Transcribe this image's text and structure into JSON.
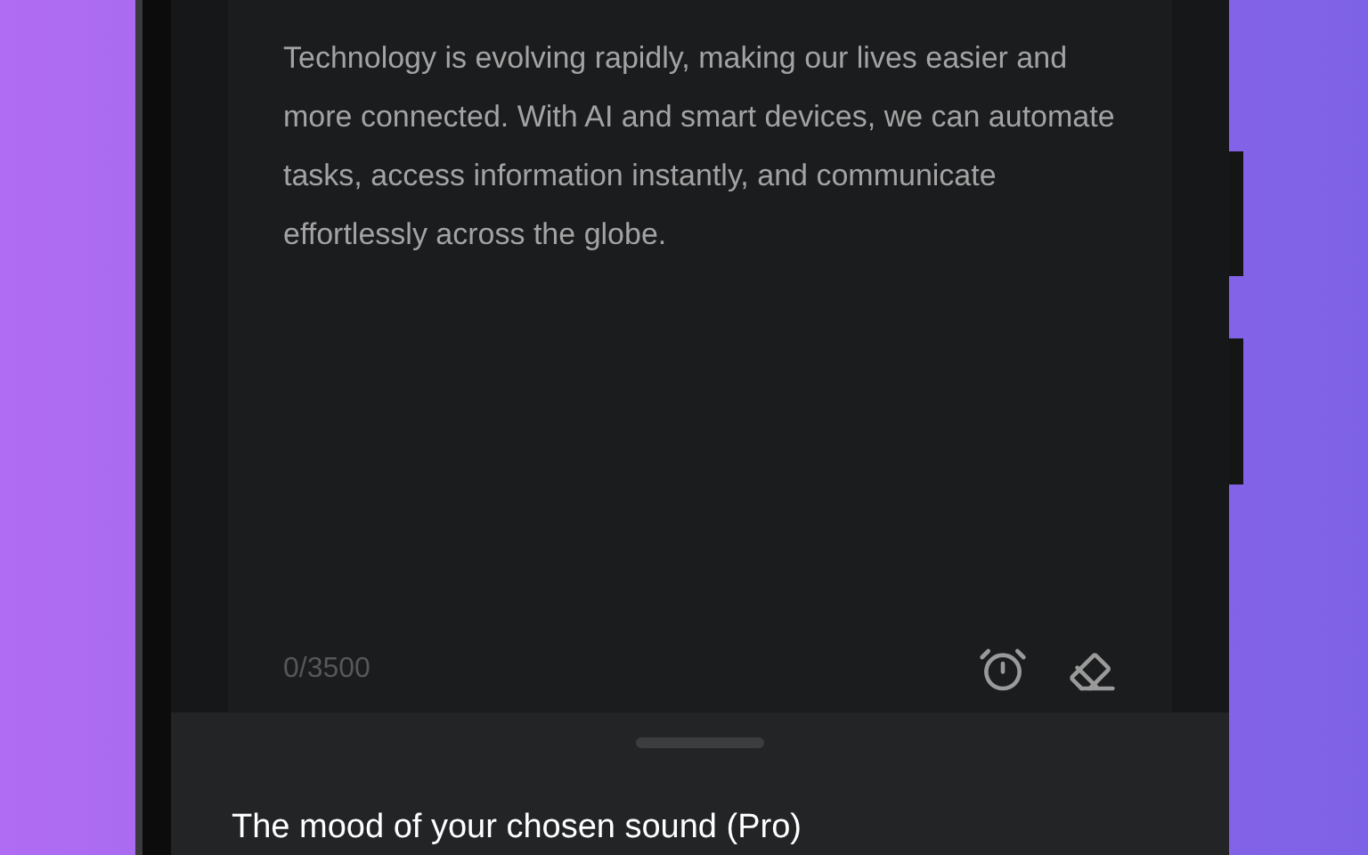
{
  "editor": {
    "text": "Technology is evolving rapidly, making our lives easier and more connected. With AI and smart devices, we can automate tasks, access information instantly, and communicate effortlessly across the globe.",
    "counter": "0/3500"
  },
  "sheet": {
    "title": "The mood of your chosen sound (Pro)"
  }
}
